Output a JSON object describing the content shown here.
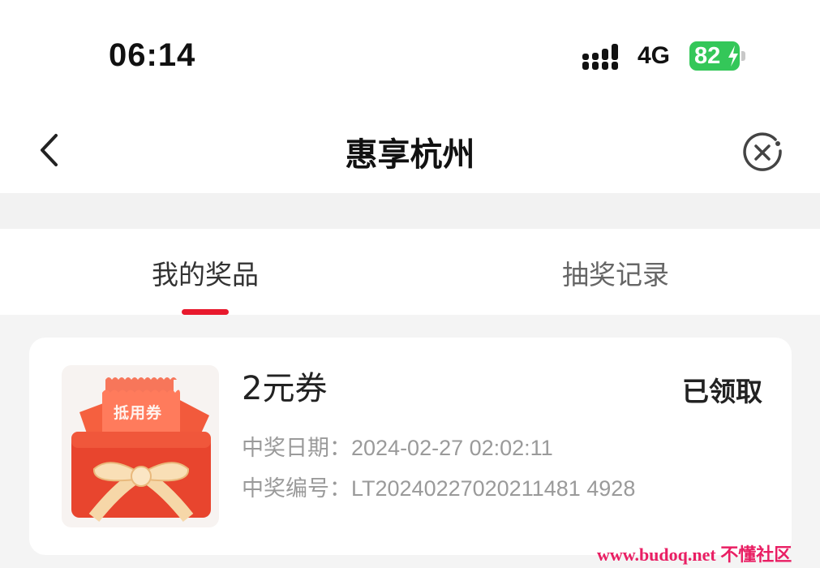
{
  "status_bar": {
    "time": "06:14",
    "network": "4G",
    "battery_level": "82",
    "battery_color": "#34c759"
  },
  "header": {
    "title": "惠享杭州",
    "back_icon": "chevron-left-icon",
    "close_icon": "close-circle-icon"
  },
  "tabs": [
    {
      "label": "我的奖品",
      "active": true
    },
    {
      "label": "抽奖记录",
      "active": false
    }
  ],
  "accent_color": "#e8192d",
  "prize_card": {
    "name": "2元券",
    "status": "已领取",
    "coupon_image_label": "抵用券",
    "date_label": "中奖日期：",
    "date_value": "2024-02-27 02:02:11",
    "code_label": "中奖编号：",
    "code_value": "LT20240227020211481 4928"
  },
  "watermark": "www.budoq.net 不懂社区"
}
